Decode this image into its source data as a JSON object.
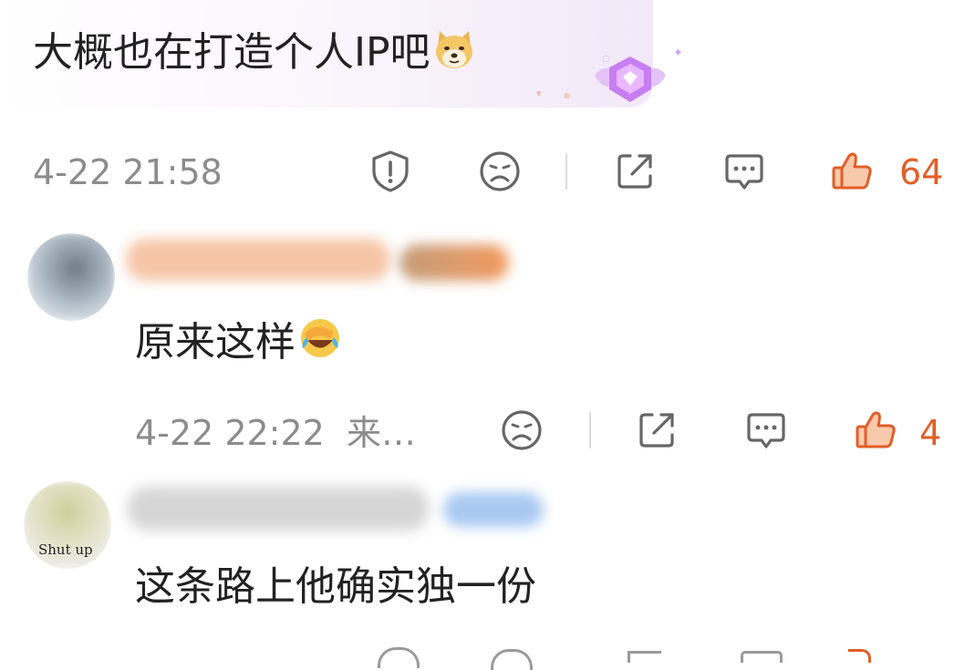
{
  "comments": [
    {
      "text": "大概也在打造个人IP吧",
      "emoji_icon": "doge-emoji",
      "badge_icon": "diamond-gem-badge",
      "timestamp": "4-22 21:58",
      "likes": "64",
      "actions": [
        "report-icon",
        "dislike-face-icon",
        "share-icon",
        "reply-icon",
        "like-icon"
      ]
    }
  ],
  "replies": [
    {
      "text": "原来这样",
      "emoji_icon": "facepalm-laugh-emoji",
      "timestamp": "4-22 22:22",
      "location": "来…",
      "likes": "4",
      "actions": [
        "dislike-face-icon",
        "share-icon",
        "reply-icon",
        "like-icon"
      ]
    },
    {
      "avatar_caption": "Shut up",
      "text": "这条路上他确实独一份"
    }
  ],
  "colors": {
    "text": "#222222",
    "meta": "#8c8c8c",
    "icon": "#666666",
    "like": "#e25e27",
    "badge": "#c77ef2"
  }
}
